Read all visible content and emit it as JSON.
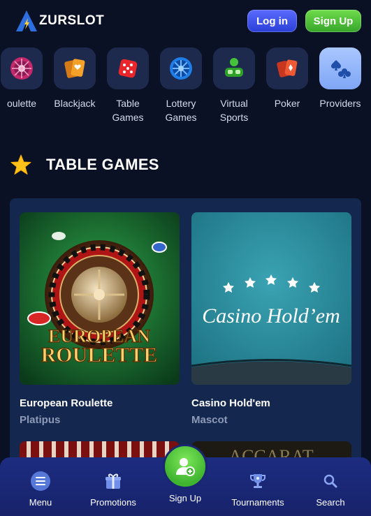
{
  "header": {
    "logo_text": "ZURSLOT",
    "login_label": "Log in",
    "signup_label": "Sign Up"
  },
  "categories": [
    {
      "label": "oulette",
      "icon": "roulette-icon"
    },
    {
      "label": "Blackjack",
      "icon": "cards-heart-icon"
    },
    {
      "label": "Table Games",
      "icon": "dice-icon"
    },
    {
      "label": "Lottery Games",
      "icon": "lottery-wheel-icon"
    },
    {
      "label": "Virtual Sports",
      "icon": "vr-headset-icon"
    },
    {
      "label": "Poker",
      "icon": "poker-cards-icon"
    },
    {
      "label": "Providers",
      "icon": "card-suits-icon"
    }
  ],
  "section": {
    "title": "TABLE GAMES",
    "icon": "star-icon"
  },
  "games": [
    {
      "name": "European Roulette",
      "provider": "Platipus",
      "art_line1": "EUROPEAN",
      "art_line2": "ROULETTE"
    },
    {
      "name": "Casino Hold'em",
      "provider": "Mascot",
      "art_title": "Casino Hold’em"
    }
  ],
  "peek_games": [
    {
      "art_text": "ACCARAT"
    }
  ],
  "bottom_nav": {
    "menu": "Menu",
    "promotions": "Promotions",
    "signup": "Sign Up",
    "tournaments": "Tournaments",
    "search": "Search"
  },
  "colors": {
    "background": "#0b1124",
    "panel": "#14274f",
    "accent_blue": "#3d52f0",
    "accent_green": "#4cc238",
    "nav": "#1c2c80"
  }
}
